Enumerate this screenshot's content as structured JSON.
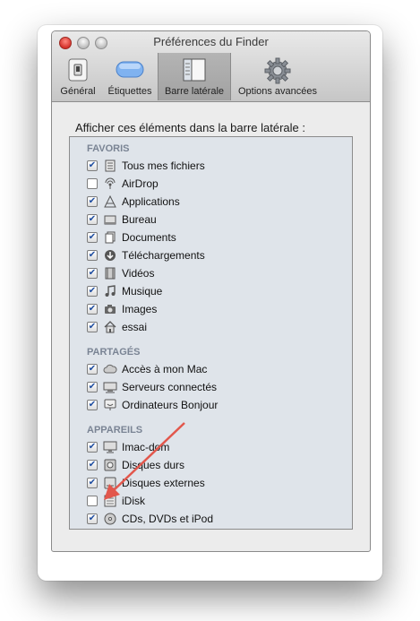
{
  "window": {
    "title": "Préférences du Finder"
  },
  "tabs": [
    {
      "label": "Général",
      "icon": "switch-icon",
      "selected": false
    },
    {
      "label": "Étiquettes",
      "icon": "label-icon",
      "selected": false
    },
    {
      "label": "Barre latérale",
      "icon": "sidebar-icon",
      "selected": true
    },
    {
      "label": "Options avancées",
      "icon": "gear-icon",
      "selected": false
    }
  ],
  "content": {
    "heading": "Afficher ces éléments dans la barre latérale :",
    "sections": {
      "favoris": {
        "title": "FAVORIS",
        "items": [
          {
            "label": "Tous mes fichiers",
            "checked": true,
            "icon": "all-files-icon"
          },
          {
            "label": "AirDrop",
            "checked": false,
            "icon": "airdrop-icon"
          },
          {
            "label": "Applications",
            "checked": true,
            "icon": "applications-icon"
          },
          {
            "label": "Bureau",
            "checked": true,
            "icon": "desktop-icon"
          },
          {
            "label": "Documents",
            "checked": true,
            "icon": "documents-icon"
          },
          {
            "label": "Téléchargements",
            "checked": true,
            "icon": "downloads-icon"
          },
          {
            "label": "Vidéos",
            "checked": true,
            "icon": "movies-icon"
          },
          {
            "label": "Musique",
            "checked": true,
            "icon": "music-icon"
          },
          {
            "label": "Images",
            "checked": true,
            "icon": "camera-icon"
          },
          {
            "label": "essai",
            "checked": true,
            "icon": "home-icon"
          }
        ]
      },
      "partages": {
        "title": "PARTAGÉS",
        "items": [
          {
            "label": "Accès à mon Mac",
            "checked": true,
            "icon": "cloud-icon"
          },
          {
            "label": "Serveurs connectés",
            "checked": true,
            "icon": "server-icon"
          },
          {
            "label": "Ordinateurs Bonjour",
            "checked": true,
            "icon": "bonjour-icon"
          }
        ]
      },
      "appareils": {
        "title": "APPAREILS",
        "items": [
          {
            "label": "Imac-dom",
            "checked": true,
            "icon": "imac-icon"
          },
          {
            "label": "Disques durs",
            "checked": true,
            "icon": "hard-disk-icon"
          },
          {
            "label": "Disques externes",
            "checked": true,
            "icon": "external-disk-icon"
          },
          {
            "label": "iDisk",
            "checked": false,
            "icon": "idisk-icon"
          },
          {
            "label": "CDs, DVDs et iPod",
            "checked": true,
            "icon": "cd-icon"
          }
        ]
      }
    }
  },
  "colors": {
    "list_background": "#dfe4ea",
    "section_title": "#7a8494",
    "checkmark": "#1e4da0",
    "annotation_arrow": "#e2574c"
  }
}
